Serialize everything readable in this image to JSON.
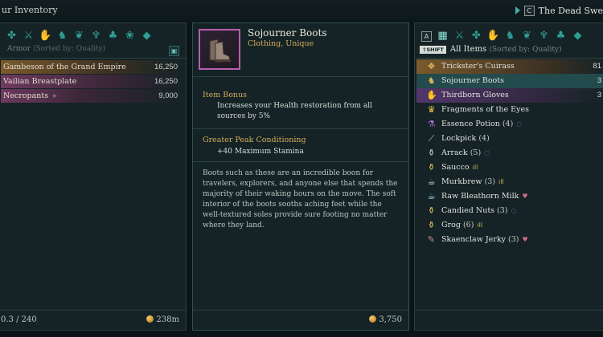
{
  "top": {
    "title": "ur Inventory",
    "key": "C",
    "location": "The Dead Swe"
  },
  "left": {
    "header": "Armor",
    "sort": "(Sorted by: Quality)",
    "items": [
      {
        "name": "Gambeson of the Grand Empire",
        "value": "16,250"
      },
      {
        "name": "Vailian Breastplate",
        "value": "16,250"
      },
      {
        "name": "Necropants",
        "value": "9,000"
      }
    ],
    "capacity": "0.3 / 240",
    "money": "238m"
  },
  "detail": {
    "name": "Sojourner Boots",
    "type": "Clothing, Unique",
    "bonus_title": "Item Bonus",
    "bonus_text": "Increases your Health restoration from all sources by 5%",
    "perk_title": "Greater Peak Conditioning",
    "perk_text": "+40 Maximum Stamina",
    "description": "Boots such as these are an incredible boon for travelers, explorers, and anyone else that spends the majority of their waking hours on the move. The soft interior of the boots sooths aching feet while the well-textured soles provide sure footing no matter where they land.",
    "value": "3,750"
  },
  "right": {
    "key_a": "A",
    "shift_label": "⇧SHIFT",
    "header": "All Items",
    "sort": "(Sorted by: Quality)",
    "items": [
      {
        "name": "Trickster's Cuirass",
        "count": "",
        "qty": "81"
      },
      {
        "name": "Sojourner Boots",
        "count": "",
        "qty": "3"
      },
      {
        "name": "Thirdborn Gloves",
        "count": "",
        "qty": "3"
      },
      {
        "name": "Fragments of the Eyes",
        "count": "",
        "qty": ""
      },
      {
        "name": "Essence Potion",
        "count": "(4)",
        "qty": ""
      },
      {
        "name": "Lockpick",
        "count": "(4)",
        "qty": ""
      },
      {
        "name": "Arrack",
        "count": "(5)",
        "qty": ""
      },
      {
        "name": "Saucco",
        "count": "",
        "qty": ""
      },
      {
        "name": "Murkbrew",
        "count": "(3)",
        "qty": ""
      },
      {
        "name": "Raw Bleathorn Milk",
        "count": "",
        "qty": ""
      },
      {
        "name": "Candied Nuts",
        "count": "(3)",
        "qty": ""
      },
      {
        "name": "Grog",
        "count": "(6)",
        "qty": ""
      },
      {
        "name": "Skaenclaw Jerky",
        "count": "(3)",
        "qty": ""
      }
    ]
  },
  "colors": {
    "accent": "#2f9f95",
    "gold": "#d4ad5d",
    "selected_row": "#234a4c",
    "rarity_gold": "#7a5a2d",
    "rarity_pink": "#6d3a5e",
    "rarity_purple": "#53366b"
  },
  "icons": [
    "arrow-indicator-icon",
    "category-armor-icon",
    "category-weapon-icon",
    "category-misc-icon",
    "coin-icon",
    "star-icon",
    "swirl-icon",
    "bars-icon",
    "heart-icon",
    "crown-icon",
    "potion-icon",
    "lockpick-icon",
    "bottle-icon",
    "cup-icon",
    "jerky-icon"
  ]
}
